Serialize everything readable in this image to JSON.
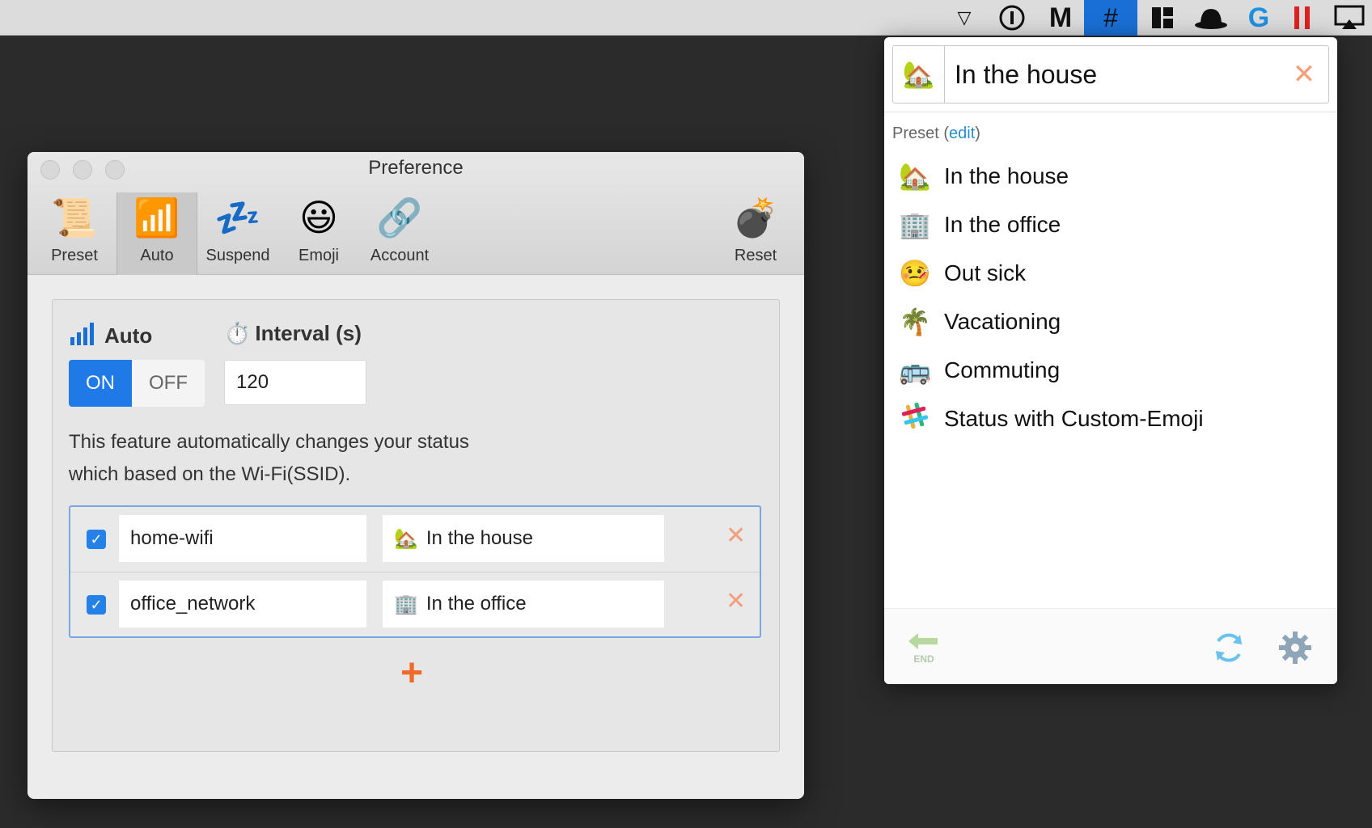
{
  "menubar": {
    "icons": [
      "chevron-down",
      "1password",
      "gmail",
      "slack-status-active",
      "layout",
      "bowler-hat",
      "logitech",
      "pause-red",
      "airplay"
    ]
  },
  "pref_window": {
    "title": "Preference",
    "toolbar": [
      {
        "label": "Preset",
        "glyph": "📜",
        "icon": "scroll-icon"
      },
      {
        "label": "Auto",
        "glyph": "📶",
        "icon": "signal-icon",
        "active": true
      },
      {
        "label": "Suspend",
        "glyph": "💤",
        "icon": "zzz-icon"
      },
      {
        "label": "Emoji",
        "glyph": "😃",
        "icon": "smiley-icon"
      },
      {
        "label": "Account",
        "glyph": "🔗",
        "icon": "link-icon"
      }
    ],
    "reset": {
      "label": "Reset",
      "glyph": "💣"
    },
    "auto": {
      "label": "Auto",
      "on_label": "ON",
      "off_label": "OFF",
      "interval_label": "Interval (s)",
      "interval_value": "120",
      "description_line1": "This feature automatically changes your status",
      "description_line2": "which based on the Wi-Fi(SSID).",
      "rows": [
        {
          "checked": true,
          "ssid": "home-wifi",
          "status": "In the house",
          "emoji": "🏡"
        },
        {
          "checked": true,
          "ssid": "office_network",
          "status": "In the office",
          "emoji": "🏢"
        }
      ],
      "add_glyph": "+"
    }
  },
  "popover": {
    "search_emoji": "🏡",
    "search_value": "In the house",
    "clear_glyph": "✕",
    "preset_label": "Preset",
    "edit_label": "edit",
    "presets": [
      {
        "emoji": "🏡",
        "label": "In the house"
      },
      {
        "emoji": "🏢",
        "label": "In the office"
      },
      {
        "emoji": "🤒",
        "label": "Out sick"
      },
      {
        "emoji": "🌴",
        "label": "Vacationing"
      },
      {
        "emoji": "🚌",
        "label": "Commuting"
      },
      {
        "emoji": "✳️",
        "label": "Status with Custom-Emoji"
      }
    ],
    "footer": {
      "end_label": "END"
    }
  },
  "colors": {
    "accent": "#1f7ae8",
    "close": "#f4a07a",
    "add": "#f06a2a"
  }
}
